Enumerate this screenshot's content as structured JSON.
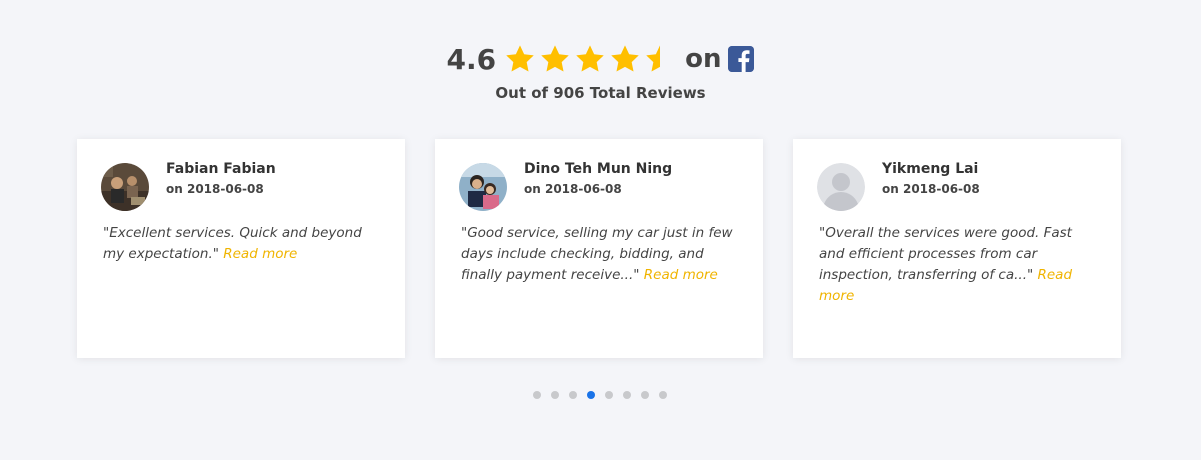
{
  "header": {
    "rating_value": "4.6",
    "stars_full": 4,
    "stars_partial": 0.5,
    "on_label": "on",
    "platform_icon": "facebook-icon",
    "subtitle": "Out of 906 Total Reviews"
  },
  "colors": {
    "star": "#ffbf00",
    "facebook": "#3b5998",
    "read_more": "#f0b400",
    "dot_active": "#1a73e8",
    "dot_inactive": "#c8c9cc",
    "background": "#f4f5f9"
  },
  "reviews": [
    {
      "name": "Fabian Fabian",
      "date": "on 2018-06-08",
      "text": "\"Excellent services. Quick and beyond my expectation.\"",
      "read_more": "Read more"
    },
    {
      "name": "Dino Teh Mun Ning",
      "date": "on 2018-06-08",
      "text": "\"Good service, selling my car just in few days include checking, bidding, and finally payment receive...\"",
      "read_more": "Read more"
    },
    {
      "name": "Yikmeng Lai",
      "date": "on 2018-06-08",
      "text": "\"Overall the services were good. Fast and efficient processes from car inspection, transferring of ca...\"",
      "read_more": "Read more"
    }
  ],
  "carousel": {
    "total_pages": 8,
    "active_index": 3
  }
}
